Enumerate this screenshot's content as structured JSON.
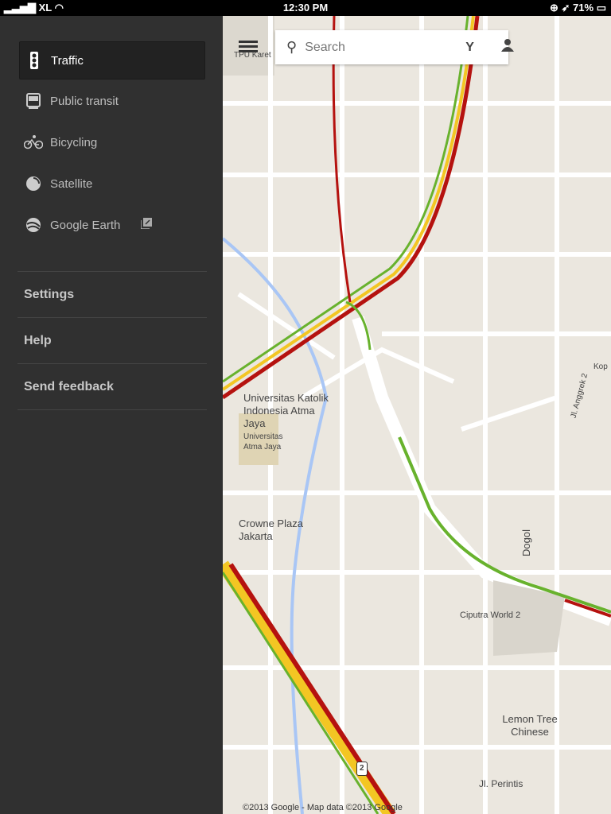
{
  "status_bar": {
    "carrier": "XL",
    "time": "12:30 PM",
    "battery": "71%"
  },
  "sidebar": {
    "layers": [
      {
        "label": "Traffic",
        "icon": "traffic-light-icon",
        "active": true
      },
      {
        "label": "Public transit",
        "icon": "train-icon",
        "active": false
      },
      {
        "label": "Bicycling",
        "icon": "bicycle-icon",
        "active": false
      },
      {
        "label": "Satellite",
        "icon": "satellite-icon",
        "active": false
      },
      {
        "label": "Google Earth",
        "icon": "google-earth-icon",
        "active": false
      }
    ],
    "sections": [
      "Settings",
      "Help",
      "Send feedback"
    ]
  },
  "search": {
    "placeholder": "Search"
  },
  "map": {
    "labels": {
      "top": "TPU Karet",
      "univ": "Universitas Katolik Indonesia Atma Jaya",
      "univ_small": "Universitas Atma Jaya",
      "crowne": "Crowne Plaza Jakarta",
      "ciputra": "Ciputra World 2",
      "lemon": "Lemon Tree Chinese",
      "anggrek": "Jl. Anggrek 2",
      "dogol": "Dogol",
      "kop": "Kop",
      "perintis": "Jl. Perintis",
      "shield": "2"
    },
    "traffic_colors": {
      "heavy": "#b5120f",
      "medium": "#f3c623",
      "free": "#68b22d"
    },
    "copyright": "©2013 Google - Map data ©2013 Google"
  }
}
